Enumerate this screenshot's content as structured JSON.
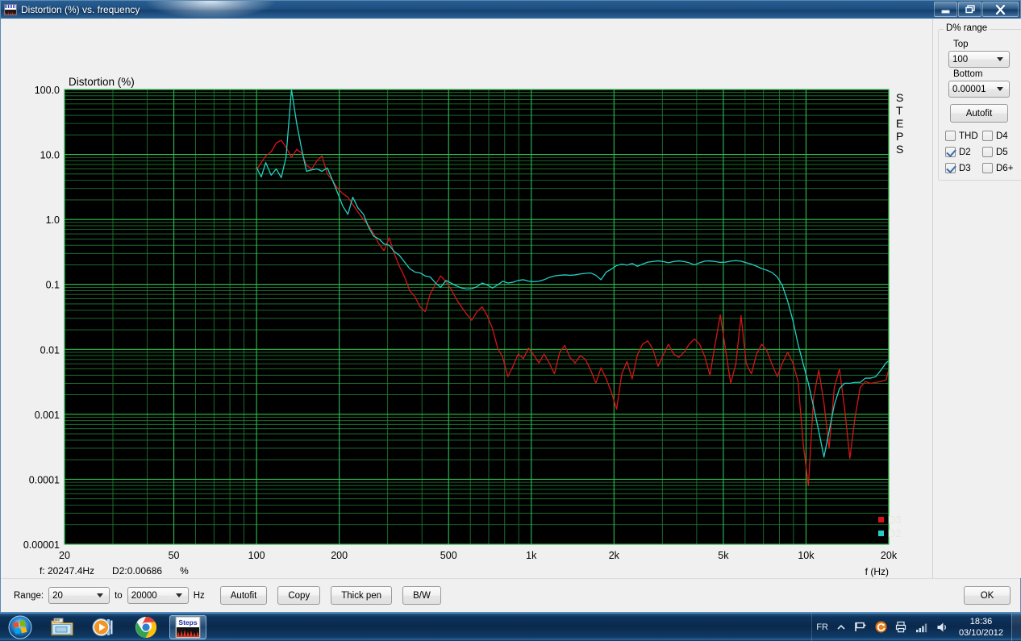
{
  "window": {
    "title": "Distortion (%) vs. frequency",
    "icon": "distortion-app-icon",
    "minimize_label": "Minimize",
    "restore_label": "Restore",
    "close_label": "Close"
  },
  "right_panel": {
    "group_title": "D% range",
    "top_label": "Top",
    "top_value": "100",
    "bottom_label": "Bottom",
    "bottom_value": "0.00001",
    "autofit_label": "Autofit",
    "harmonics": [
      {
        "label": "THD",
        "checked": false
      },
      {
        "label": "D4",
        "checked": false
      },
      {
        "label": "D2",
        "checked": true
      },
      {
        "label": "D5",
        "checked": false
      },
      {
        "label": "D3",
        "checked": true
      },
      {
        "label": "D6+",
        "checked": false
      }
    ]
  },
  "bottom_bar": {
    "range_label": "Range:",
    "range_from": "20",
    "to_label": "to",
    "range_to": "20000",
    "unit_label": "Hz",
    "autofit_label": "Autofit",
    "copy_label": "Copy",
    "thick_pen_label": "Thick pen",
    "bw_label": "B/W",
    "ok_label": "OK"
  },
  "readout": {
    "frequency": "f: 20247.4Hz",
    "value": "D2:0.00686",
    "unit": "%"
  },
  "side_label": "STEPS",
  "taskbar": {
    "start_label": "Start",
    "items": [
      {
        "name": "explorer",
        "label": "Windows Explorer",
        "active": false
      },
      {
        "name": "media-player",
        "label": "Windows Media Player",
        "active": false
      },
      {
        "name": "chrome",
        "label": "Google Chrome",
        "active": false
      },
      {
        "name": "steps",
        "label": "Steps",
        "active": true
      }
    ],
    "tray": {
      "language": "FR",
      "icons": [
        "chevron-up-icon",
        "flag-icon",
        "update-icon",
        "printer-icon",
        "network-icon",
        "volume-icon"
      ],
      "time": "18:36",
      "date": "03/10/2012"
    }
  },
  "chart_data": {
    "type": "line",
    "title": "Distortion (%)",
    "xlabel": "f (Hz)",
    "ylabel": "Distortion (%)",
    "xscale": "log",
    "yscale": "log",
    "xlim": [
      20,
      20000
    ],
    "ylim": [
      1e-05,
      100
    ],
    "grid": true,
    "background": "#000000",
    "grid_color": "#1f7a33",
    "grid_major_color": "#2fbf4f",
    "xticks": [
      20,
      50,
      100,
      200,
      500,
      1000,
      2000,
      5000,
      10000,
      20000
    ],
    "xtick_labels": [
      "20",
      "50",
      "100",
      "200",
      "500",
      "1k",
      "2k",
      "5k",
      "10k",
      "20k"
    ],
    "yticks": [
      100,
      10,
      1,
      0.1,
      0.01,
      0.001,
      0.0001,
      1e-05
    ],
    "ytick_labels": [
      "100.0",
      "10.0",
      "1.0",
      "0.1",
      "0.01",
      "0.001",
      "0.0001",
      "0.00001"
    ],
    "legend": [
      {
        "name": "D3",
        "color": "#d81414"
      },
      {
        "name": "D2",
        "color": "#22cfc4"
      }
    ],
    "legend_position": "bottom-right",
    "series": [
      {
        "name": "D3",
        "color": "#d81414",
        "x": [
          100,
          104,
          108,
          113,
          118,
          123,
          128,
          134,
          140,
          146,
          152,
          159,
          166,
          173,
          181,
          189,
          197,
          206,
          215,
          224,
          234,
          245,
          256,
          267,
          279,
          291,
          304,
          317,
          331,
          346,
          361,
          377,
          394,
          411,
          429,
          448,
          468,
          489,
          510,
          533,
          557,
          581,
          607,
          634,
          662,
          691,
          722,
          754,
          787,
          822,
          858,
          896,
          936,
          977,
          1021,
          1066,
          1113,
          1162,
          1214,
          1268,
          1324,
          1383,
          1444,
          1508,
          1575,
          1645,
          1718,
          1794,
          1874,
          1957,
          2044,
          2135,
          2230,
          2329,
          2432,
          2540,
          2653,
          2771,
          2894,
          3022,
          3156,
          3296,
          3443,
          3596,
          3756,
          3923,
          4097,
          4279,
          4469,
          4668,
          4875,
          5092,
          5318,
          5554,
          5801,
          6058,
          6327,
          6608,
          6901,
          7207,
          7527,
          7861,
          8210,
          8574,
          8955,
          9352,
          9767,
          10200,
          10653,
          11126,
          11620,
          12135,
          12674,
          13236,
          13824,
          14438,
          15079,
          15748,
          16447,
          17177,
          17940,
          18736,
          19567,
          20247
        ],
        "y": [
          5.8,
          7.5,
          9.5,
          11.0,
          15.0,
          16.5,
          13.0,
          9.0,
          12.0,
          10.5,
          6.8,
          6.0,
          8.0,
          9.5,
          5.0,
          4.0,
          3.0,
          2.5,
          2.2,
          1.7,
          1.3,
          1.0,
          0.8,
          0.6,
          0.42,
          0.33,
          0.52,
          0.3,
          0.19,
          0.13,
          0.08,
          0.065,
          0.045,
          0.038,
          0.072,
          0.1,
          0.135,
          0.11,
          0.085,
          0.06,
          0.045,
          0.035,
          0.028,
          0.038,
          0.045,
          0.033,
          0.021,
          0.0105,
          0.0075,
          0.0038,
          0.0055,
          0.0085,
          0.0072,
          0.0105,
          0.0082,
          0.0062,
          0.0085,
          0.0062,
          0.0042,
          0.009,
          0.0115,
          0.0075,
          0.0062,
          0.008,
          0.007,
          0.0048,
          0.003,
          0.0052,
          0.0035,
          0.0022,
          0.0012,
          0.0042,
          0.0065,
          0.0035,
          0.0082,
          0.012,
          0.0135,
          0.01,
          0.0055,
          0.0082,
          0.012,
          0.0085,
          0.0075,
          0.009,
          0.012,
          0.0145,
          0.012,
          0.0078,
          0.004,
          0.012,
          0.034,
          0.01,
          0.003,
          0.006,
          0.033,
          0.006,
          0.0042,
          0.0085,
          0.012,
          0.0095,
          0.0058,
          0.0038,
          0.0062,
          0.009,
          0.0062,
          0.0032,
          0.00035,
          8e-05,
          0.0018,
          0.0048,
          0.0015,
          0.0003,
          0.0026,
          0.005,
          0.0012,
          0.00021,
          0.0009,
          0.0026,
          0.0032,
          0.003,
          0.0031,
          0.0032,
          0.0034,
          0.006,
          0.0069
        ]
      },
      {
        "name": "D2",
        "color": "#22cfc4",
        "x": [
          100,
          104,
          108,
          113,
          118,
          123,
          128,
          134,
          140,
          146,
          152,
          159,
          166,
          173,
          181,
          189,
          197,
          206,
          215,
          224,
          234,
          245,
          256,
          267,
          279,
          291,
          304,
          317,
          331,
          346,
          361,
          377,
          394,
          411,
          429,
          448,
          468,
          489,
          510,
          533,
          557,
          581,
          607,
          634,
          662,
          691,
          722,
          754,
          787,
          822,
          858,
          896,
          936,
          977,
          1021,
          1066,
          1113,
          1162,
          1214,
          1268,
          1324,
          1383,
          1444,
          1508,
          1575,
          1645,
          1718,
          1794,
          1874,
          1957,
          2044,
          2135,
          2230,
          2329,
          2432,
          2540,
          2653,
          2771,
          2894,
          3022,
          3156,
          3296,
          3443,
          3596,
          3756,
          3923,
          4097,
          4279,
          4469,
          4668,
          4875,
          5092,
          5318,
          5554,
          5801,
          6058,
          6327,
          6608,
          6901,
          7207,
          7527,
          7861,
          8210,
          8574,
          8955,
          9352,
          9767,
          10200,
          10653,
          11126,
          11620,
          12135,
          12674,
          13236,
          13824,
          14438,
          15079,
          15748,
          16447,
          17177,
          17940,
          18736,
          19567,
          20247
        ],
        "y": [
          6.3,
          4.5,
          7.5,
          4.8,
          6.0,
          4.4,
          9.0,
          100.0,
          30.0,
          12.0,
          5.5,
          5.8,
          6.0,
          5.5,
          6.2,
          4.0,
          2.6,
          1.6,
          1.2,
          2.2,
          1.5,
          1.2,
          0.75,
          0.55,
          0.5,
          0.42,
          0.4,
          0.32,
          0.28,
          0.22,
          0.175,
          0.155,
          0.15,
          0.135,
          0.13,
          0.105,
          0.09,
          0.115,
          0.105,
          0.095,
          0.088,
          0.085,
          0.086,
          0.092,
          0.105,
          0.098,
          0.088,
          0.098,
          0.112,
          0.105,
          0.108,
          0.115,
          0.118,
          0.112,
          0.11,
          0.112,
          0.118,
          0.128,
          0.135,
          0.138,
          0.14,
          0.138,
          0.14,
          0.145,
          0.148,
          0.15,
          0.138,
          0.118,
          0.155,
          0.172,
          0.195,
          0.205,
          0.198,
          0.21,
          0.19,
          0.205,
          0.22,
          0.225,
          0.23,
          0.225,
          0.215,
          0.225,
          0.23,
          0.225,
          0.215,
          0.2,
          0.215,
          0.228,
          0.23,
          0.225,
          0.218,
          0.22,
          0.228,
          0.232,
          0.228,
          0.215,
          0.205,
          0.19,
          0.175,
          0.165,
          0.152,
          0.13,
          0.095,
          0.055,
          0.028,
          0.012,
          0.006,
          0.003,
          0.0013,
          0.00055,
          0.00022,
          0.00055,
          0.0014,
          0.0025,
          0.003,
          0.003,
          0.0031,
          0.0031,
          0.0036,
          0.0036,
          0.0038,
          0.0048,
          0.0062,
          0.0069
        ]
      }
    ]
  }
}
